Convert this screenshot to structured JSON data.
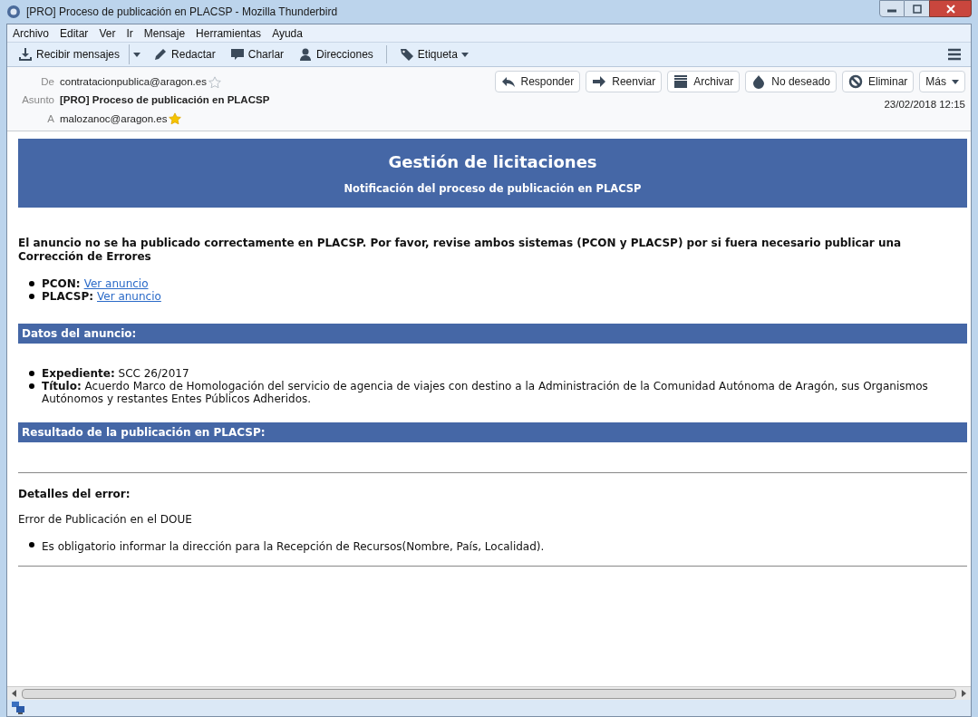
{
  "window": {
    "title": "[PRO] Proceso de publicación en PLACSP - Mozilla Thunderbird"
  },
  "menu": [
    "Archivo",
    "Editar",
    "Ver",
    "Ir",
    "Mensaje",
    "Herramientas",
    "Ayuda"
  ],
  "toolbar": [
    {
      "label": "Recibir mensajes",
      "kind": "receive"
    },
    {
      "label": "Redactar",
      "kind": "compose"
    },
    {
      "label": "Charlar",
      "kind": "chat"
    },
    {
      "label": "Direcciones",
      "kind": "contacts"
    },
    {
      "label": "Etiqueta",
      "kind": "tag"
    }
  ],
  "header": {
    "from_label": "De",
    "from": "contratacionpublica@aragon.es",
    "from_starred": false,
    "subject_label": "Asunto",
    "subject": "[PRO] Proceso de publicación en PLACSP",
    "to_label": "A",
    "to": "malozanoc@aragon.es",
    "to_starred": true,
    "date": "23/02/2018 12:15",
    "actions": [
      {
        "label": "Responder",
        "kind": "reply"
      },
      {
        "label": "Reenviar",
        "kind": "forward"
      },
      {
        "label": "Archivar",
        "kind": "archive"
      },
      {
        "label": "No deseado",
        "kind": "junk"
      },
      {
        "label": "Eliminar",
        "kind": "delete"
      },
      {
        "label": "Más",
        "kind": "more"
      }
    ]
  },
  "email": {
    "banner_title": "Gestión de licitaciones",
    "banner_subtitle": "Notificación del proceso de publicación en PLACSP",
    "intro": "El anuncio no se ha publicado correctamente en PLACSP. Por favor, revise ambos sistemas (PCON y PLACSP) por si fuera necesario publicar una Corrección de Errores",
    "links": [
      {
        "label": "PCON:",
        "link": "Ver anuncio"
      },
      {
        "label": "PLACSP:",
        "link": "Ver anuncio"
      }
    ],
    "data_heading": "Datos del anuncio:",
    "data_items": [
      {
        "label": "Expediente:",
        "value": "SCC 26/2017"
      },
      {
        "label": "Título:",
        "value": "Acuerdo Marco de Homologación del servicio de agencia de viajes con destino a la Administración de la Comunidad Autónoma de Aragón, sus Organismos Autónomos y restantes Entes Públicos Adheridos."
      }
    ],
    "result_heading": "Resultado de la publicación en PLACSP:",
    "error_heading": "Detalles del error:",
    "error_text": "Error de Publicación en el DOUE",
    "error_items": [
      "Es obligatorio informar la dirección para la Recepción de Recursos(Nombre, País, Localidad)."
    ]
  }
}
